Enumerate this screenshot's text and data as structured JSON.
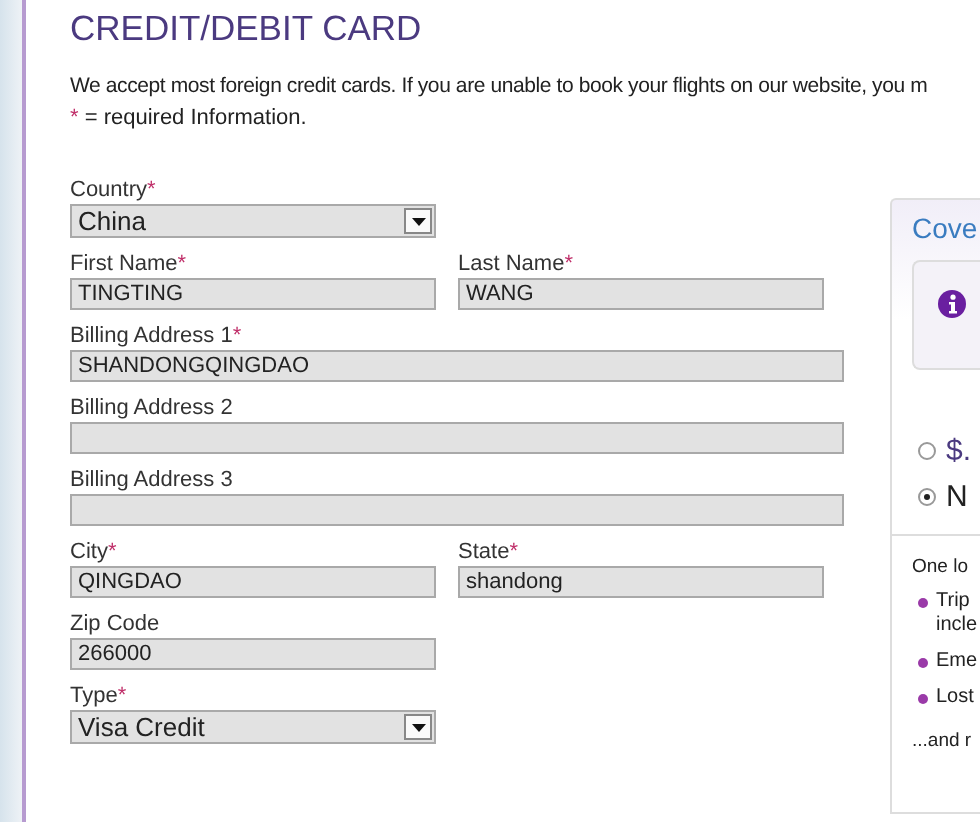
{
  "title": "CREDIT/DEBIT CARD",
  "intro": "We accept most foreign credit cards. If you are unable to book your flights on our website, you m",
  "required_note": {
    "mark": "*",
    "text": " = required Information."
  },
  "form_rows": [
    {
      "fields": [
        {
          "kind": "select",
          "label": "Country",
          "required": true,
          "value": "China"
        }
      ]
    },
    {
      "fields": [
        {
          "kind": "text",
          "label": "First Name",
          "required": true,
          "value": "TINGTING"
        },
        {
          "kind": "text",
          "label": "Last Name",
          "required": true,
          "value": "WANG"
        }
      ]
    },
    {
      "fields": [
        {
          "kind": "long_text",
          "label": "Billing Address 1",
          "required": true,
          "value": "SHANDONGQINGDAO"
        }
      ]
    },
    {
      "fields": [
        {
          "kind": "long_text",
          "label": "Billing Address 2",
          "required": false
        }
      ]
    },
    {
      "fields": [
        {
          "kind": "long_text",
          "label": "Billing Address 3",
          "required": false
        }
      ]
    },
    {
      "fields": [
        {
          "kind": "text",
          "label": "City",
          "required": true,
          "value": "QINGDAO"
        },
        {
          "kind": "text",
          "label": "State",
          "required": true,
          "value": "shandong"
        }
      ]
    },
    {
      "fields": [
        {
          "kind": "text",
          "label": "Zip Code",
          "required": false,
          "value": "266000"
        }
      ]
    },
    {
      "fields": [
        {
          "kind": "select",
          "label": "Type",
          "required": true,
          "value": "Visa Credit"
        }
      ]
    }
  ],
  "cover_panel": {
    "title": "Cove",
    "options": [
      {
        "label": "$.",
        "selected": false
      },
      {
        "label": "N",
        "selected": true
      }
    ],
    "lead": "One lo",
    "bullets": [
      "Trip incle",
      "Eme",
      "Lost"
    ],
    "more": "...and r"
  }
}
